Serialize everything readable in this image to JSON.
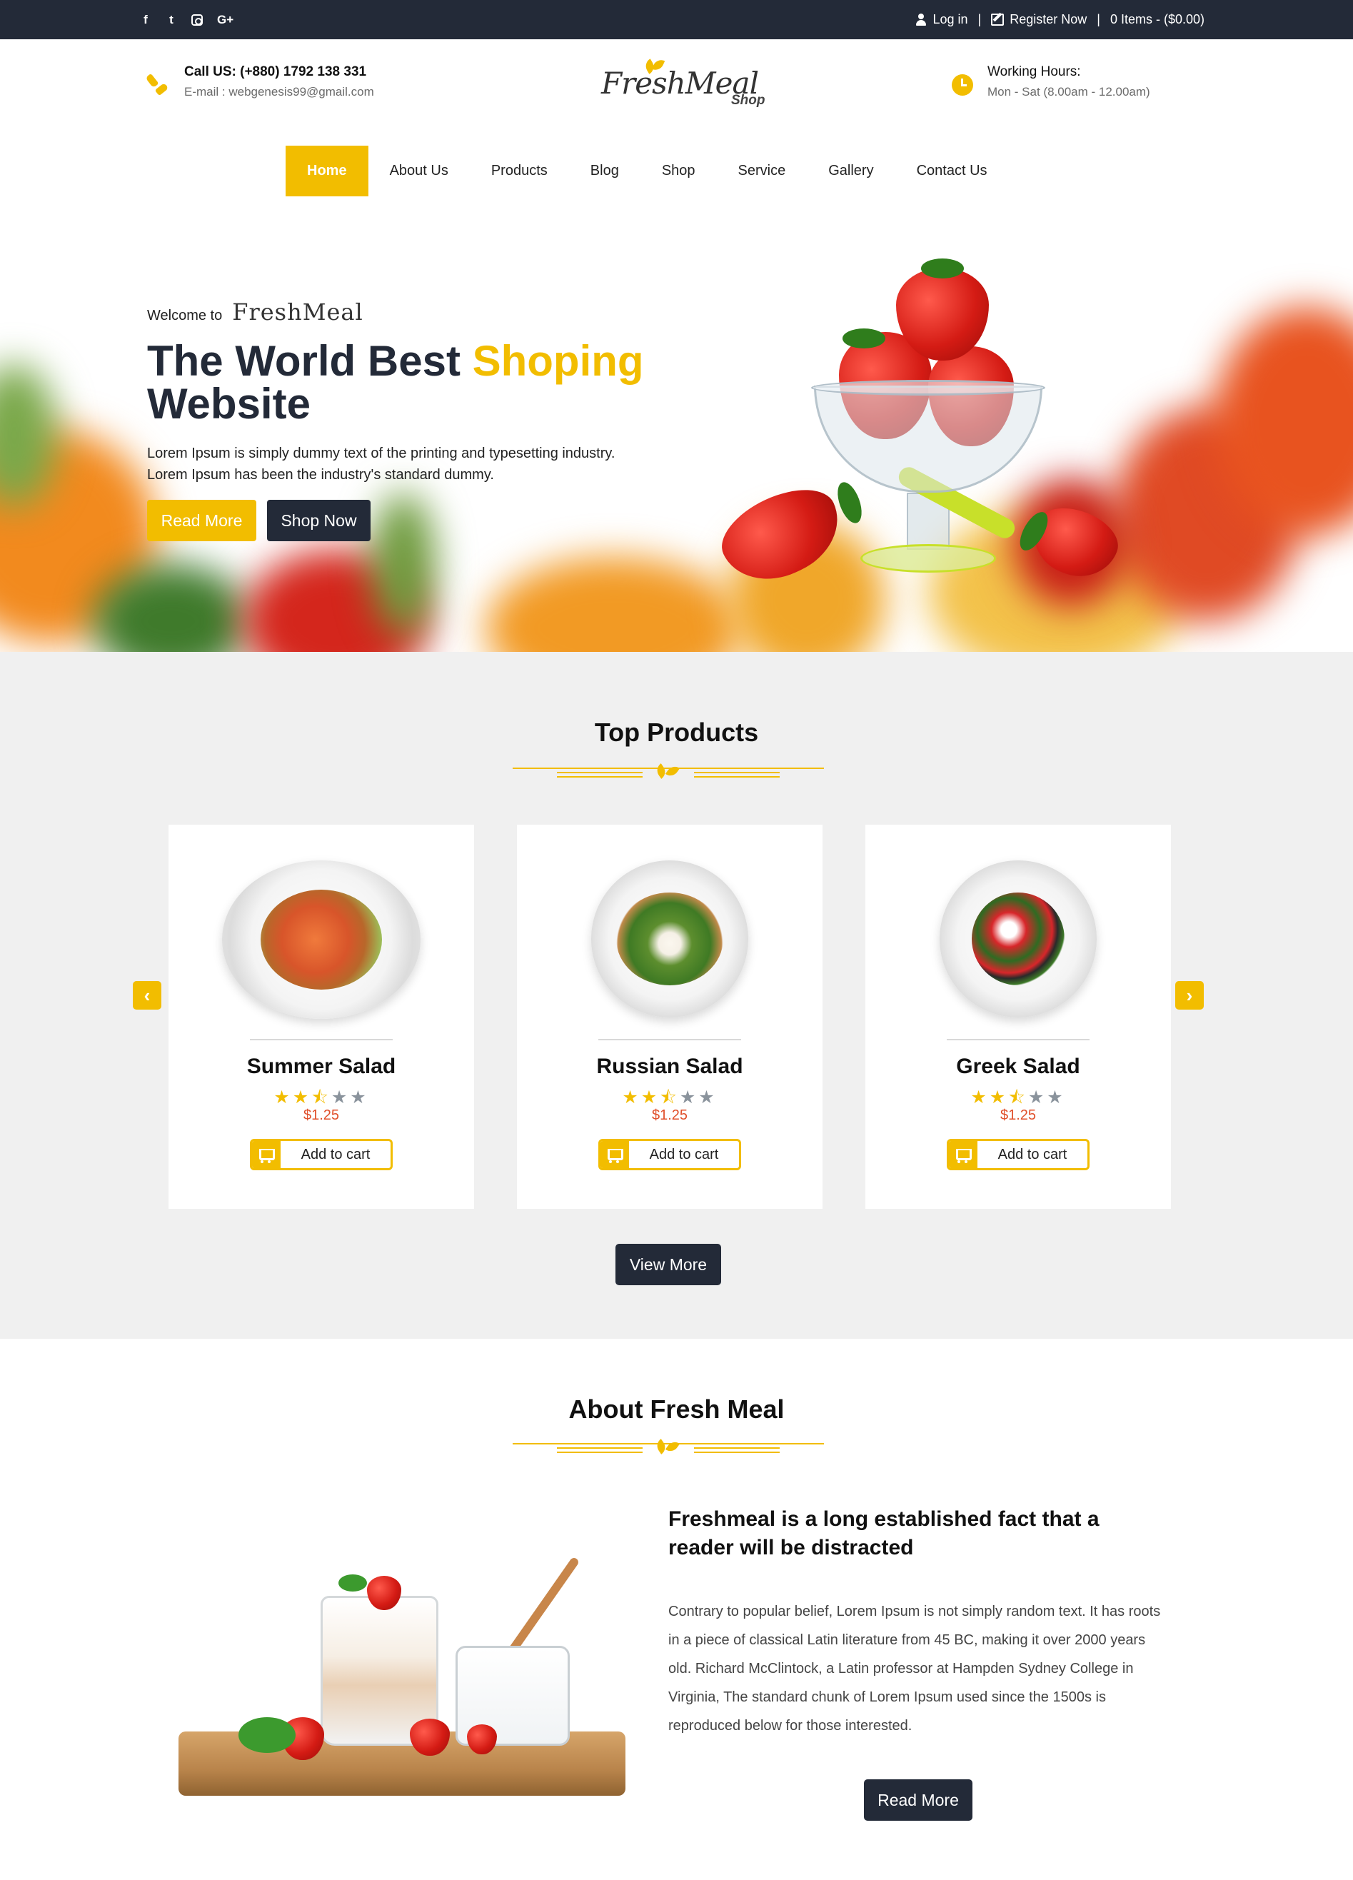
{
  "topbar": {
    "social": [
      "f",
      "t",
      "instagram",
      "G+"
    ],
    "login": "Log in",
    "register": "Register Now",
    "separator": "|",
    "cart_summary": "0 Items - ($0.00)"
  },
  "header": {
    "call_label": "Call US: (+880) 1792 138 331",
    "email": "E-mail : webgenesis99@gmail.com",
    "logo_script": "FreshMeal",
    "logo_shop": "Shop",
    "hours_label": "Working Hours:",
    "hours_value": "Mon - Sat (8.00am - 12.00am)"
  },
  "nav": {
    "items": [
      "Home",
      "About Us",
      "Products",
      "Blog",
      "Shop",
      "Service",
      "Gallery",
      "Contact Us"
    ],
    "active": "Home"
  },
  "hero": {
    "welcome_label": "Welcome to",
    "welcome_brand": "FreshMeal",
    "title_part1": "The World Best ",
    "title_highlight": "Shoping",
    "title_part2": "Website",
    "description": "Lorem Ipsum is simply dummy text of the printing and typesetting industry. Lorem Ipsum has been the industry's standard dummy.",
    "btn_read_more": "Read More",
    "btn_shop_now": "Shop Now"
  },
  "products": {
    "title": "Top Products",
    "prev_arrow": "‹",
    "next_arrow": "›",
    "items": [
      {
        "name": "Summer Salad",
        "rating": 2.5,
        "price": "$1.25",
        "cart_label": "Add to cart"
      },
      {
        "name": "Russian Salad",
        "rating": 2.5,
        "price": "$1.25",
        "cart_label": "Add to cart"
      },
      {
        "name": "Greek Salad",
        "rating": 2.5,
        "price": "$1.25",
        "cart_label": "Add to cart"
      }
    ],
    "view_more": "View More"
  },
  "about": {
    "title": "About Fresh Meal",
    "heading": "Freshmeal is a long established fact that a reader will be distracted",
    "body": "Contrary to popular belief, Lorem Ipsum is not simply random text. It has roots in a piece of classical Latin literature from 45 BC, making it over 2000 years old. Richard McClintock, a Latin professor at Hampden Sydney College in Virginia, The standard chunk of Lorem Ipsum used since the 1500s is reproduced below for those interested.",
    "btn_read_more": "Read More"
  },
  "colors": {
    "accent": "#f2bd00",
    "dark": "#232a38",
    "price": "#e04f2a",
    "section_bg": "#f0f0f0"
  }
}
